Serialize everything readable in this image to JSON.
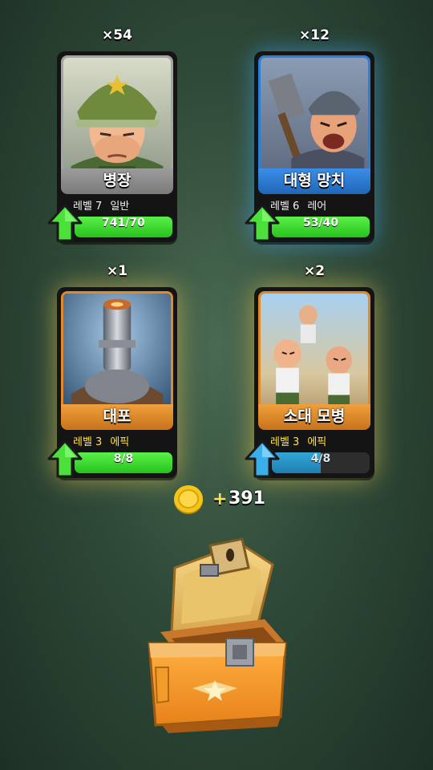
{
  "cards": [
    {
      "count": "×54",
      "name": "병장",
      "level": "레벨 7",
      "rarity": "일반",
      "progress": "741/70",
      "fill_fraction": 1.0,
      "upgradeable": true,
      "rarity_color": "#9c9c9c"
    },
    {
      "count": "×12",
      "name": "대형 망치",
      "level": "레벨 6",
      "rarity": "레어",
      "progress": "53/40",
      "fill_fraction": 1.0,
      "upgradeable": true,
      "rarity_color": "#2f7fd8"
    },
    {
      "count": "×1",
      "name": "대포",
      "level": "레벨 3",
      "rarity": "에픽",
      "progress": "8/8",
      "fill_fraction": 1.0,
      "upgradeable": true,
      "rarity_color": "#e08a2c"
    },
    {
      "count": "×2",
      "name": "소대 모병",
      "level": "레벨 3",
      "rarity": "에픽",
      "progress": "4/8",
      "fill_fraction": 0.5,
      "upgradeable": false,
      "rarity_color": "#e08a2c"
    }
  ],
  "reward": {
    "plus": "+",
    "coins": "391",
    "icon": "gold-coin-icon"
  },
  "chest": {
    "icon": "loot-chest-icon"
  },
  "colors": {
    "upgrade_arrow": "#4be03a",
    "progress_arrow": "#3aaee8"
  }
}
